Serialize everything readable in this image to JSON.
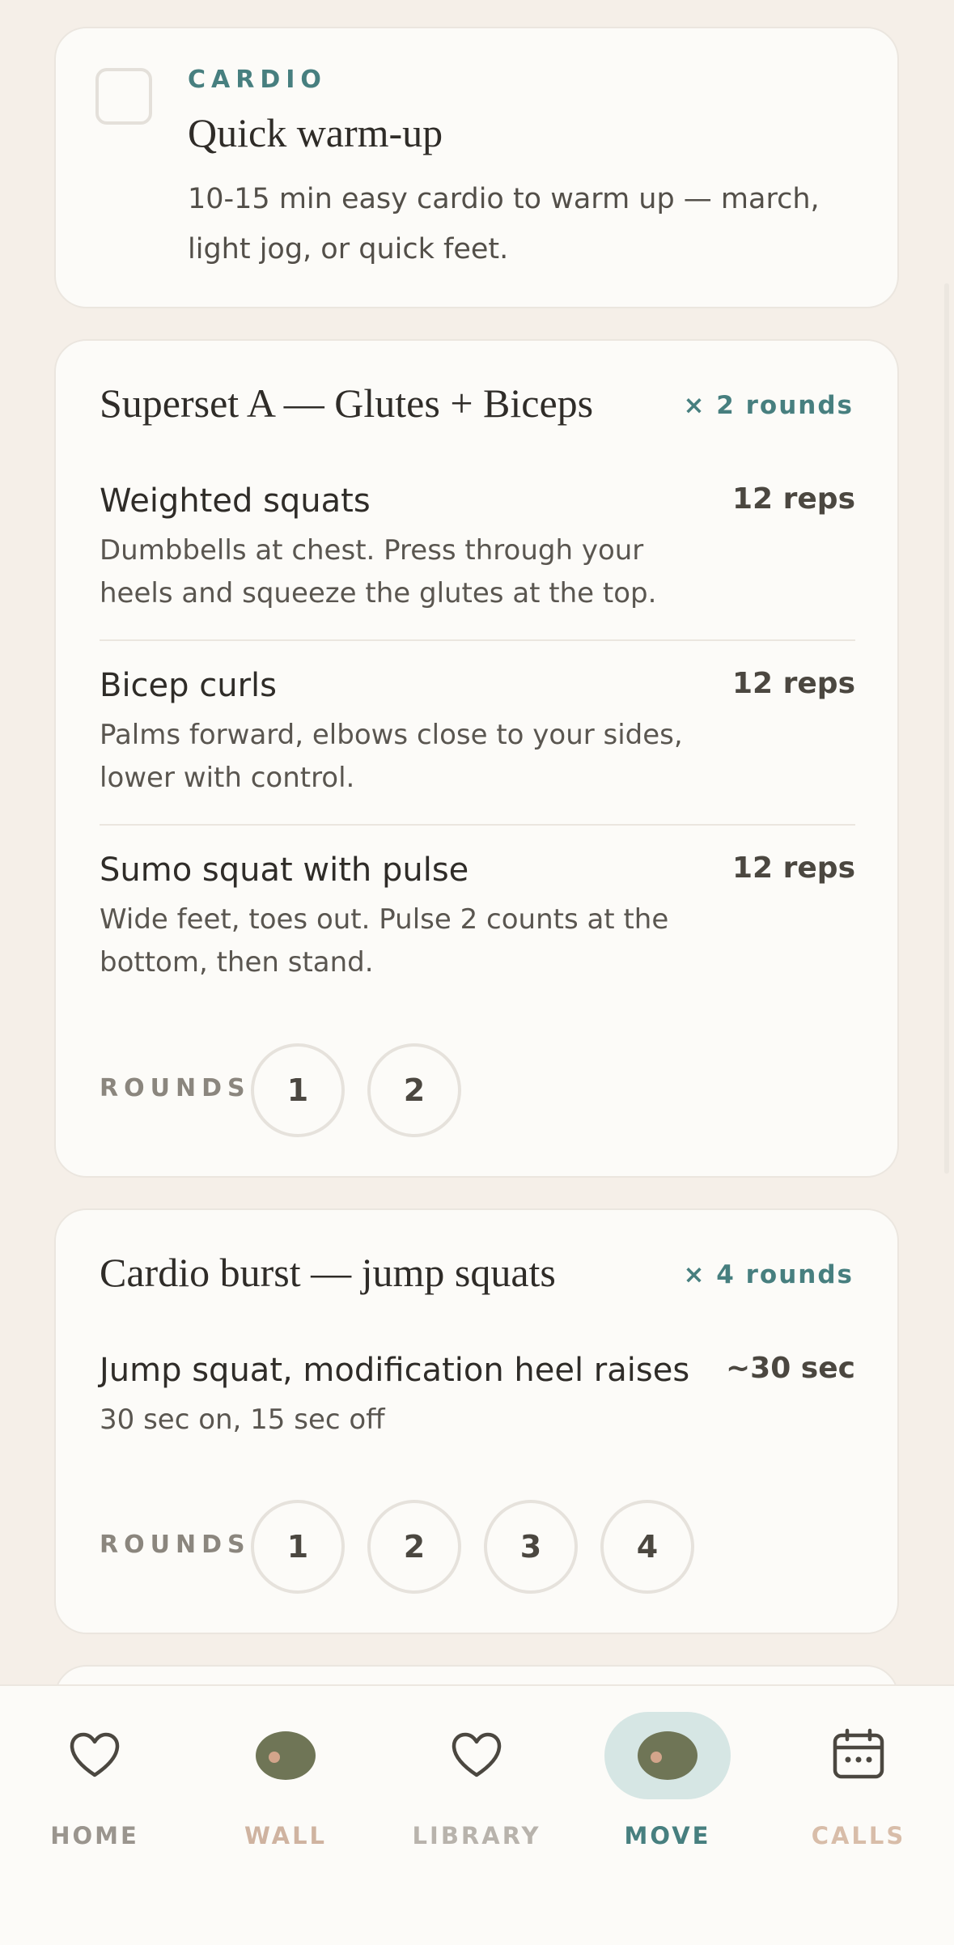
{
  "warmup": {
    "eyebrow": "CARDIO",
    "title": "Quick warm-up",
    "description": "10-15 min easy cardio to warm up — march, light jog, or quick feet."
  },
  "superset": {
    "title": "Superset A — Glutes + Biceps",
    "rounds_mult": "× 2 rounds",
    "exercises": [
      {
        "name": "Weighted squats",
        "description": "Dumbbells at chest. Press through your heels and squeeze the glutes at the top.",
        "reps": "12 reps"
      },
      {
        "name": "Bicep curls",
        "description": "Palms forward, elbows close to your sides, lower with control.",
        "reps": "12 reps"
      },
      {
        "name": "Sumo squat with pulse",
        "description": "Wide feet, toes out. Pulse 2 counts at the bottom, then stand.",
        "reps": "12 reps"
      }
    ],
    "rounds_label": "ROUNDS",
    "rounds": [
      "1",
      "2"
    ]
  },
  "cardio_burst": {
    "title": "Cardio burst — jump squats",
    "rounds_mult": "× 4 rounds",
    "exercises": [
      {
        "name": "Jump squat, modification heel raises",
        "description": "30 sec on, 15 sec off",
        "reps": "~30 sec"
      }
    ],
    "rounds_label": "ROUNDS",
    "rounds": [
      "1",
      "2",
      "3",
      "4"
    ]
  },
  "nav": {
    "items": [
      {
        "label": "HOME",
        "icon": "heart-icon",
        "color": "#9a958e"
      },
      {
        "label": "WALL",
        "icon": "blob-icon",
        "color": "#cfb3a0"
      },
      {
        "label": "LIBRARY",
        "icon": "heart-icon",
        "color": "#b8b3ac"
      },
      {
        "label": "MOVE",
        "icon": "blob-icon",
        "color": "#477f7f",
        "active": true
      },
      {
        "label": "CALLS",
        "icon": "calendar-icon",
        "color": "#d8bda9"
      }
    ]
  },
  "colors": {
    "accent": "#477f7f",
    "background": "#f5efe8",
    "card": "#fcfbf8",
    "active_pill": "#d6e6e4"
  }
}
